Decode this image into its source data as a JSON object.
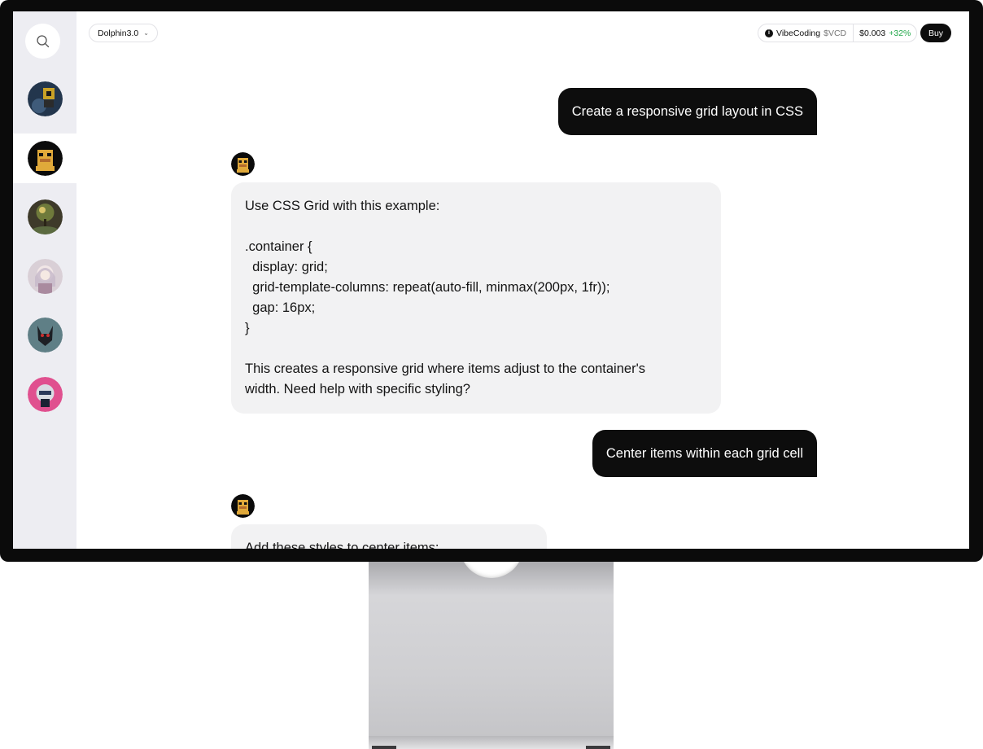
{
  "topbar": {
    "model_label": "Dolphin3.0",
    "token_name": "VibeCoding",
    "token_symbol": "$VCD",
    "token_price": "$0.003",
    "token_change": "+32%",
    "buy_label": "Buy"
  },
  "colors": {
    "accent_dark": "#0d0d0d",
    "sidebar_bg": "#ededf2",
    "bot_bubble_bg": "#f2f2f3",
    "positive": "#22a84a"
  },
  "icons": {
    "search": "search-icon",
    "chevron": "chevron-down-icon",
    "info": "info-icon"
  },
  "sidebar": {
    "items": [
      {
        "name": "avatar-1"
      },
      {
        "name": "avatar-2",
        "active": true
      },
      {
        "name": "avatar-3"
      },
      {
        "name": "avatar-4"
      },
      {
        "name": "avatar-5"
      },
      {
        "name": "avatar-6"
      }
    ]
  },
  "chat": {
    "messages": [
      {
        "role": "user",
        "text": "Create a responsive grid layout in CSS"
      },
      {
        "role": "assistant",
        "lines": [
          "Use CSS Grid with this example:",
          "",
          ".container {",
          "  display: grid;",
          "  grid-template-columns: repeat(auto-fill, minmax(200px, 1fr));",
          "  gap: 16px;",
          "}",
          "",
          "This creates a responsive grid where items adjust to the container's",
          "width. Need help with specific styling?"
        ]
      },
      {
        "role": "user",
        "text": "Center items within each grid cell"
      },
      {
        "role": "assistant",
        "lines": [
          "Add these styles to center items:"
        ]
      }
    ]
  }
}
